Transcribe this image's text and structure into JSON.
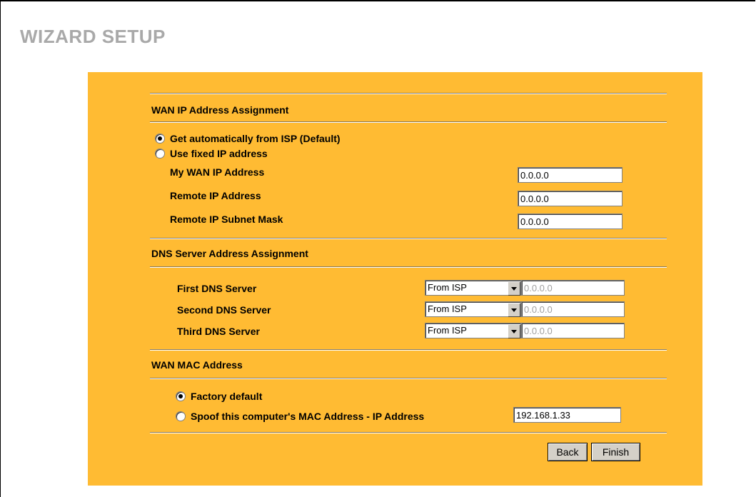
{
  "page": {
    "title": "WIZARD SETUP"
  },
  "wan_ip": {
    "heading": "WAN IP Address Assignment",
    "option_auto": "Get automatically from ISP (Default)",
    "option_fixed": "Use fixed IP address",
    "selected": "auto",
    "fields": [
      {
        "label": "My WAN IP Address",
        "value": "0.0.0.0"
      },
      {
        "label": "Remote IP Address",
        "value": "0.0.0.0"
      },
      {
        "label": "Remote IP Subnet Mask",
        "value": "0.0.0.0"
      }
    ]
  },
  "dns": {
    "heading": "DNS Server Address Assignment",
    "servers": [
      {
        "label": "First DNS Server",
        "mode": "From ISP",
        "value": "0.0.0.0"
      },
      {
        "label": "Second DNS Server",
        "mode": "From ISP",
        "value": "0.0.0.0"
      },
      {
        "label": "Third DNS Server",
        "mode": "From ISP",
        "value": "0.0.0.0"
      }
    ]
  },
  "mac": {
    "heading": "WAN MAC Address",
    "option_factory": "Factory default",
    "option_spoof": "Spoof this computer's MAC Address - IP Address",
    "selected": "factory",
    "spoof_ip": "192.168.1.33"
  },
  "buttons": {
    "back": "Back",
    "finish": "Finish"
  },
  "colors": {
    "panel": "#ffbb33",
    "title": "#a9a9a9",
    "button_face": "#d4d0c8"
  },
  "icons": {
    "dropdown": "chevron-down-icon"
  }
}
